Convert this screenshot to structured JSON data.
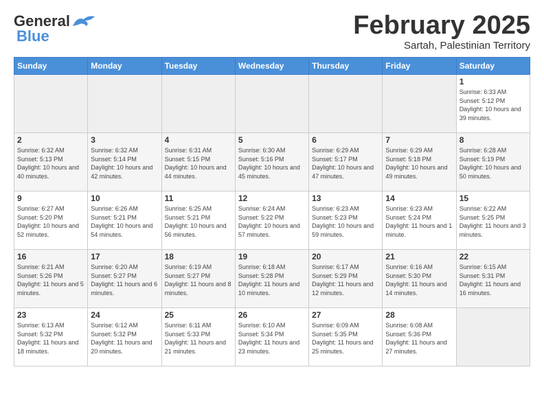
{
  "header": {
    "logo_general": "General",
    "logo_blue": "Blue",
    "month_title": "February 2025",
    "subtitle": "Sartah, Palestinian Territory"
  },
  "days_of_week": [
    "Sunday",
    "Monday",
    "Tuesday",
    "Wednesday",
    "Thursday",
    "Friday",
    "Saturday"
  ],
  "weeks": [
    [
      {
        "num": "",
        "info": ""
      },
      {
        "num": "",
        "info": ""
      },
      {
        "num": "",
        "info": ""
      },
      {
        "num": "",
        "info": ""
      },
      {
        "num": "",
        "info": ""
      },
      {
        "num": "",
        "info": ""
      },
      {
        "num": "1",
        "info": "Sunrise: 6:33 AM\nSunset: 5:12 PM\nDaylight: 10 hours and 39 minutes."
      }
    ],
    [
      {
        "num": "2",
        "info": "Sunrise: 6:32 AM\nSunset: 5:13 PM\nDaylight: 10 hours and 40 minutes."
      },
      {
        "num": "3",
        "info": "Sunrise: 6:32 AM\nSunset: 5:14 PM\nDaylight: 10 hours and 42 minutes."
      },
      {
        "num": "4",
        "info": "Sunrise: 6:31 AM\nSunset: 5:15 PM\nDaylight: 10 hours and 44 minutes."
      },
      {
        "num": "5",
        "info": "Sunrise: 6:30 AM\nSunset: 5:16 PM\nDaylight: 10 hours and 45 minutes."
      },
      {
        "num": "6",
        "info": "Sunrise: 6:29 AM\nSunset: 5:17 PM\nDaylight: 10 hours and 47 minutes."
      },
      {
        "num": "7",
        "info": "Sunrise: 6:29 AM\nSunset: 5:18 PM\nDaylight: 10 hours and 49 minutes."
      },
      {
        "num": "8",
        "info": "Sunrise: 6:28 AM\nSunset: 5:19 PM\nDaylight: 10 hours and 50 minutes."
      }
    ],
    [
      {
        "num": "9",
        "info": "Sunrise: 6:27 AM\nSunset: 5:20 PM\nDaylight: 10 hours and 52 minutes."
      },
      {
        "num": "10",
        "info": "Sunrise: 6:26 AM\nSunset: 5:21 PM\nDaylight: 10 hours and 54 minutes."
      },
      {
        "num": "11",
        "info": "Sunrise: 6:25 AM\nSunset: 5:21 PM\nDaylight: 10 hours and 56 minutes."
      },
      {
        "num": "12",
        "info": "Sunrise: 6:24 AM\nSunset: 5:22 PM\nDaylight: 10 hours and 57 minutes."
      },
      {
        "num": "13",
        "info": "Sunrise: 6:23 AM\nSunset: 5:23 PM\nDaylight: 10 hours and 59 minutes."
      },
      {
        "num": "14",
        "info": "Sunrise: 6:23 AM\nSunset: 5:24 PM\nDaylight: 11 hours and 1 minute."
      },
      {
        "num": "15",
        "info": "Sunrise: 6:22 AM\nSunset: 5:25 PM\nDaylight: 11 hours and 3 minutes."
      }
    ],
    [
      {
        "num": "16",
        "info": "Sunrise: 6:21 AM\nSunset: 5:26 PM\nDaylight: 11 hours and 5 minutes."
      },
      {
        "num": "17",
        "info": "Sunrise: 6:20 AM\nSunset: 5:27 PM\nDaylight: 11 hours and 6 minutes."
      },
      {
        "num": "18",
        "info": "Sunrise: 6:19 AM\nSunset: 5:27 PM\nDaylight: 11 hours and 8 minutes."
      },
      {
        "num": "19",
        "info": "Sunrise: 6:18 AM\nSunset: 5:28 PM\nDaylight: 11 hours and 10 minutes."
      },
      {
        "num": "20",
        "info": "Sunrise: 6:17 AM\nSunset: 5:29 PM\nDaylight: 11 hours and 12 minutes."
      },
      {
        "num": "21",
        "info": "Sunrise: 6:16 AM\nSunset: 5:30 PM\nDaylight: 11 hours and 14 minutes."
      },
      {
        "num": "22",
        "info": "Sunrise: 6:15 AM\nSunset: 5:31 PM\nDaylight: 11 hours and 16 minutes."
      }
    ],
    [
      {
        "num": "23",
        "info": "Sunrise: 6:13 AM\nSunset: 5:32 PM\nDaylight: 11 hours and 18 minutes."
      },
      {
        "num": "24",
        "info": "Sunrise: 6:12 AM\nSunset: 5:32 PM\nDaylight: 11 hours and 20 minutes."
      },
      {
        "num": "25",
        "info": "Sunrise: 6:11 AM\nSunset: 5:33 PM\nDaylight: 11 hours and 21 minutes."
      },
      {
        "num": "26",
        "info": "Sunrise: 6:10 AM\nSunset: 5:34 PM\nDaylight: 11 hours and 23 minutes."
      },
      {
        "num": "27",
        "info": "Sunrise: 6:09 AM\nSunset: 5:35 PM\nDaylight: 11 hours and 25 minutes."
      },
      {
        "num": "28",
        "info": "Sunrise: 6:08 AM\nSunset: 5:36 PM\nDaylight: 11 hours and 27 minutes."
      },
      {
        "num": "",
        "info": ""
      }
    ]
  ]
}
